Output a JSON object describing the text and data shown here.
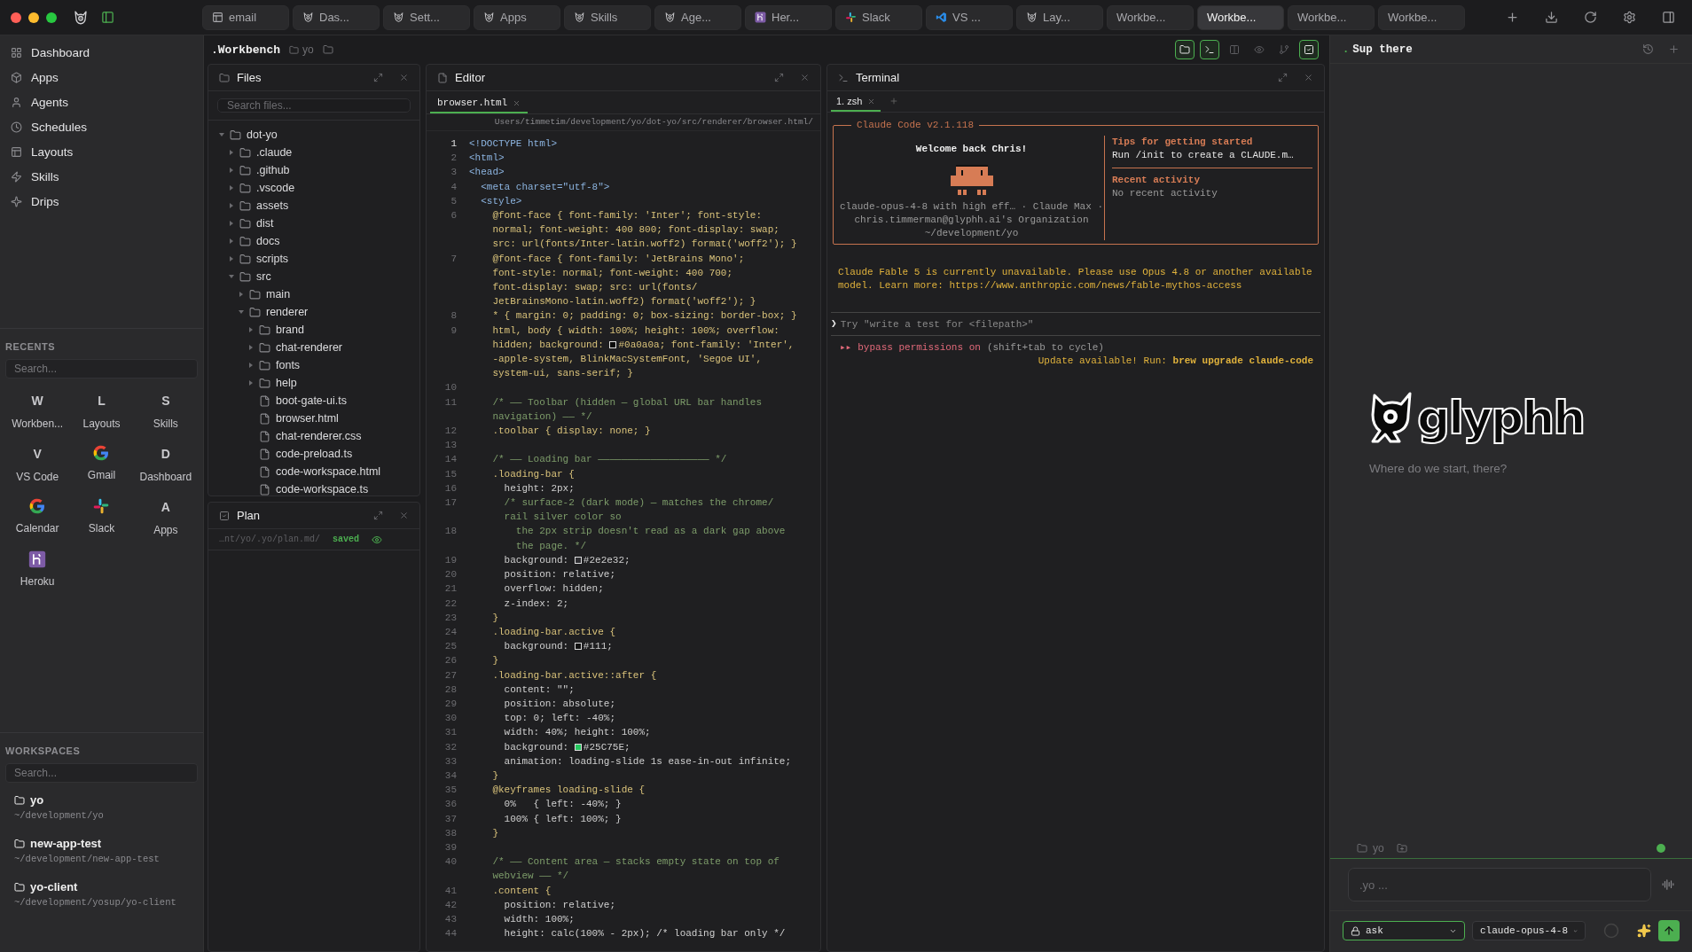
{
  "top_tabs": [
    {
      "label": "email",
      "kind": "layout",
      "selected": false
    },
    {
      "label": "Das...",
      "kind": "cat",
      "selected": false
    },
    {
      "label": "Sett...",
      "kind": "cat",
      "selected": false
    },
    {
      "label": "Apps",
      "kind": "cat",
      "selected": false
    },
    {
      "label": "Skills",
      "kind": "cat",
      "selected": false
    },
    {
      "label": "Age...",
      "kind": "cat",
      "selected": false
    },
    {
      "label": "Her...",
      "kind": "heroku",
      "selected": false
    },
    {
      "label": "Slack",
      "kind": "slack",
      "selected": false
    },
    {
      "label": "VS ...",
      "kind": "vscode",
      "selected": false
    },
    {
      "label": "Lay...",
      "kind": "cat",
      "selected": false
    },
    {
      "label": "Workbe...",
      "selected": false
    },
    {
      "label": "Workbe...",
      "selected": true
    },
    {
      "label": "Workbe...",
      "selected": false
    },
    {
      "label": "Workbe...",
      "selected": false
    }
  ],
  "sidebar": {
    "nav": [
      {
        "label": "Dashboard",
        "kind": "grid"
      },
      {
        "label": "Apps",
        "kind": "cube"
      },
      {
        "label": "Agents",
        "kind": "person"
      },
      {
        "label": "Schedules",
        "kind": "clock"
      },
      {
        "label": "Layouts",
        "kind": "layout"
      },
      {
        "label": "Skills",
        "kind": "zap"
      },
      {
        "label": "Drips",
        "kind": "sparkle"
      }
    ],
    "recents": {
      "title": "RECENTS",
      "placeholder": "Search...",
      "items": [
        {
          "kind": "letter",
          "letter": "W",
          "label": "Workben..."
        },
        {
          "kind": "letter",
          "letter": "L",
          "label": "Layouts"
        },
        {
          "kind": "letter",
          "letter": "S",
          "label": "Skills"
        },
        {
          "kind": "letter",
          "letter": "V",
          "label": "VS Code"
        },
        {
          "kind": "google",
          "label": "Gmail"
        },
        {
          "kind": "letter",
          "letter": "D",
          "label": "Dashboard"
        },
        {
          "kind": "google",
          "label": "Calendar"
        },
        {
          "kind": "slack",
          "label": "Slack"
        },
        {
          "kind": "letter",
          "letter": "A",
          "label": "Apps"
        },
        {
          "kind": "heroku",
          "label": "Heroku"
        }
      ]
    },
    "workspaces": {
      "title": "WORKSPACES",
      "placeholder": "Search...",
      "items": [
        {
          "name": "yo",
          "path": "~/development/yo"
        },
        {
          "name": "new-app-test",
          "path": "~/development/new-app-test"
        },
        {
          "name": "yo-client",
          "path": "~/development/yosup/yo-client"
        }
      ]
    }
  },
  "workbench": {
    "title": ".Workbench",
    "folder": "yo",
    "tools": [
      {
        "kind": "folder",
        "on": true
      },
      {
        "kind": "terminal",
        "on": true
      },
      {
        "kind": "split",
        "on": false
      },
      {
        "kind": "eye",
        "on": false
      },
      {
        "kind": "branch",
        "on": false
      },
      {
        "kind": "check",
        "on": true
      }
    ]
  },
  "files": {
    "title": "Files",
    "placeholder": "Search files...",
    "tree": [
      {
        "name": "dot-yo",
        "kind": "folder",
        "expanded": true,
        "children": [
          {
            "name": ".claude",
            "kind": "folder",
            "expanded": false
          },
          {
            "name": ".github",
            "kind": "folder",
            "expanded": false
          },
          {
            "name": ".vscode",
            "kind": "folder",
            "expanded": false
          },
          {
            "name": "assets",
            "kind": "folder",
            "expanded": false
          },
          {
            "name": "dist",
            "kind": "folder",
            "expanded": false
          },
          {
            "name": "docs",
            "kind": "folder",
            "expanded": false
          },
          {
            "name": "scripts",
            "kind": "folder",
            "expanded": false
          },
          {
            "name": "src",
            "kind": "folder",
            "expanded": true,
            "children": [
              {
                "name": "main",
                "kind": "folder",
                "expanded": false
              },
              {
                "name": "renderer",
                "kind": "folder",
                "expanded": true,
                "children": [
                  {
                    "name": "brand",
                    "kind": "folder",
                    "expanded": false
                  },
                  {
                    "name": "chat-renderer",
                    "kind": "folder",
                    "expanded": false
                  },
                  {
                    "name": "fonts",
                    "kind": "folder",
                    "expanded": false
                  },
                  {
                    "name": "help",
                    "kind": "folder",
                    "expanded": false
                  },
                  {
                    "name": "boot-gate-ui.ts",
                    "kind": "file"
                  },
                  {
                    "name": "browser.html",
                    "kind": "file"
                  },
                  {
                    "name": "chat-renderer.css",
                    "kind": "file"
                  },
                  {
                    "name": "code-preload.ts",
                    "kind": "file"
                  },
                  {
                    "name": "code-workspace.html",
                    "kind": "file"
                  },
                  {
                    "name": "code-workspace.ts",
                    "kind": "file"
                  }
                ]
              }
            ]
          }
        ]
      }
    ]
  },
  "plan": {
    "title": "Plan",
    "path": "…nt/yo/.yo/plan.md/",
    "status": "saved"
  },
  "editor": {
    "title": "Editor",
    "tabs": [
      {
        "label": "browser.html",
        "selected": true
      }
    ],
    "path": "Users/timmetim/development/yo/dot-yo/src/renderer/browser.html/",
    "lines": [
      {
        "n": "1",
        "kind": "tag",
        "text": [
          "<!DOCTYPE html>"
        ]
      },
      {
        "n": "2",
        "kind": "tag",
        "text": [
          "<html>"
        ]
      },
      {
        "n": "3",
        "kind": "tag",
        "text": [
          "<head>"
        ]
      },
      {
        "n": "4",
        "kind": "tag",
        "text": [
          "  <meta charset=\"utf-8\">"
        ]
      },
      {
        "n": "5",
        "kind": "tag",
        "text": [
          "  <style>"
        ]
      },
      {
        "n": "6",
        "kind": "rule",
        "text": [
          "    @font-face { font-family: 'Inter'; font-style:",
          "    normal; font-weight: 400 800; font-display: swap;",
          "    src: url(fonts/Inter-latin.woff2) format('woff2'); }"
        ]
      },
      {
        "n": "7",
        "kind": "rule",
        "text": [
          "    @font-face { font-family: 'JetBrains Mono';",
          "    font-style: normal; font-weight: 400 700;",
          "    font-display: swap; src: url(fonts/",
          "    JetBrainsMono-latin.woff2) format('woff2'); }"
        ]
      },
      {
        "n": "8",
        "kind": "rule",
        "text": [
          "    * { margin: 0; padding: 0; box-sizing: border-box; }"
        ]
      },
      {
        "n": "9",
        "kind": "rule",
        "text": [
          "    html, body { width: 100%; height: 100%; overflow:",
          [
            "    hidden; background: ",
            {
              "color": "#0a0a0a"
            },
            "#0a0a0a; font-family: 'Inter',"
          ],
          "    -apple-system, BlinkMacSystemFont, 'Segoe UI',",
          "    system-ui, sans-serif; }"
        ]
      },
      {
        "n": "10",
        "kind": "blank"
      },
      {
        "n": "11",
        "kind": "comment",
        "text": [
          "    /* —— Toolbar (hidden — global URL bar handles",
          "    navigation) —— */"
        ]
      },
      {
        "n": "12",
        "kind": "rule",
        "text": [
          "    .toolbar { display: none; }"
        ]
      },
      {
        "n": "13",
        "kind": "blank"
      },
      {
        "n": "14",
        "kind": "comment",
        "text": [
          "    /* —— Loading bar ——————————————————— */"
        ]
      },
      {
        "n": "15",
        "kind": "rule",
        "text": [
          "    .loading-bar {"
        ]
      },
      {
        "n": "16",
        "kind": "prop",
        "text": [
          "      height: 2px;"
        ]
      },
      {
        "n": "17",
        "kind": "comment",
        "text": [
          "      /* surface-2 (dark mode) — matches the chrome/",
          "      rail silver color so"
        ]
      },
      {
        "n": "18",
        "kind": "comment",
        "text": [
          "        the 2px strip doesn't read as a dark gap above",
          "        the page. */"
        ]
      },
      {
        "n": "19",
        "kind": "prop",
        "text": [
          [
            "      background: ",
            {
              "color": "#2e2e32"
            },
            "#2e2e32;"
          ]
        ]
      },
      {
        "n": "20",
        "kind": "prop",
        "text": [
          "      position: relative;"
        ]
      },
      {
        "n": "21",
        "kind": "prop",
        "text": [
          "      overflow: hidden;"
        ]
      },
      {
        "n": "22",
        "kind": "prop",
        "text": [
          "      z-index: 2;"
        ]
      },
      {
        "n": "23",
        "kind": "rule",
        "text": [
          "    }"
        ]
      },
      {
        "n": "24",
        "kind": "rule",
        "text": [
          "    .loading-bar.active {"
        ]
      },
      {
        "n": "25",
        "kind": "prop",
        "text": [
          [
            "      background: ",
            {
              "color": "#111111"
            },
            "#111;"
          ]
        ]
      },
      {
        "n": "26",
        "kind": "rule",
        "text": [
          "    }"
        ]
      },
      {
        "n": "27",
        "kind": "rule",
        "text": [
          "    .loading-bar.active::after {"
        ]
      },
      {
        "n": "28",
        "kind": "prop",
        "text": [
          "      content: \"\";"
        ]
      },
      {
        "n": "29",
        "kind": "prop",
        "text": [
          "      position: absolute;"
        ]
      },
      {
        "n": "30",
        "kind": "prop",
        "text": [
          "      top: 0; left: -40%;"
        ]
      },
      {
        "n": "31",
        "kind": "prop",
        "text": [
          "      width: 40%; height: 100%;"
        ]
      },
      {
        "n": "32",
        "kind": "prop",
        "text": [
          [
            "      background: ",
            {
              "color": "#25c75e"
            },
            "#25C75E;"
          ]
        ]
      },
      {
        "n": "33",
        "kind": "prop",
        "text": [
          "      animation: loading-slide 1s ease-in-out infinite;"
        ]
      },
      {
        "n": "34",
        "kind": "rule",
        "text": [
          "    }"
        ]
      },
      {
        "n": "35",
        "kind": "rule",
        "text": [
          "    @keyframes loading-slide {"
        ]
      },
      {
        "n": "36",
        "kind": "prop",
        "text": [
          "      0%   { left: -40%; }"
        ]
      },
      {
        "n": "37",
        "kind": "prop",
        "text": [
          "      100% { left: 100%; }"
        ]
      },
      {
        "n": "38",
        "kind": "rule",
        "text": [
          "    }"
        ]
      },
      {
        "n": "39",
        "kind": "blank"
      },
      {
        "n": "40",
        "kind": "comment",
        "text": [
          "    /* —— Content area — stacks empty state on top of",
          "    webview —— */"
        ]
      },
      {
        "n": "41",
        "kind": "rule",
        "text": [
          "    .content {"
        ]
      },
      {
        "n": "42",
        "kind": "prop",
        "text": [
          "      position: relative;"
        ]
      },
      {
        "n": "43",
        "kind": "prop",
        "text": [
          "      width: 100%;"
        ]
      },
      {
        "n": "44",
        "kind": "prop",
        "text": [
          "      height: calc(100% - 2px); /* loading bar only */"
        ]
      }
    ]
  },
  "terminal": {
    "title": "Terminal",
    "tabs": [
      {
        "label": "1. zsh",
        "selected": true
      }
    ],
    "box_title": "Claude Code v2.1.118",
    "welcome": "Welcome back Chris!",
    "info": [
      "claude-opus-4-8 with high eff… · Claude Max ·",
      "chris.timmerman@glyphh.ai's Organization",
      "~/development/yo"
    ],
    "tips_title": "Tips for getting started",
    "tips": "Run /init to create a CLAUDE.m…",
    "activity_title": "Recent activity",
    "activity": "No recent activity",
    "warning": "Claude Fable 5 is currently unavailable. Please use Opus 4.8 or another available model. Learn more: https://www.anthropic.com/news/fable-mythos-access",
    "prompt": "❯",
    "placeholder": "Try \"write a test for <filepath>\"",
    "mode_mark": "▸▸",
    "mode": "bypass permissions on",
    "mode_hint": "(shift+tab to cycle)",
    "update": "Update available! Run: **brew upgrade claude-code**"
  },
  "chat": {
    "mark": ".",
    "title": "Sup there",
    "logo": "glyphh",
    "subtitle": "Where do we start, there?",
    "folder": "yo",
    "placeholder": ".yo ...",
    "mode": "ask",
    "model": "claude-opus-4-8"
  }
}
